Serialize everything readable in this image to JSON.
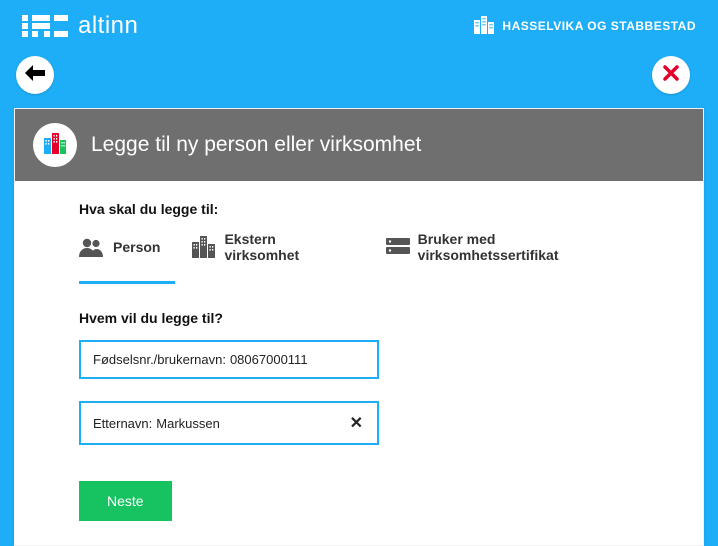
{
  "brand": {
    "name": "altinn"
  },
  "org": {
    "name": "HASSELVIKA OG STABBESTAD"
  },
  "panel": {
    "title": "Legge til ny person eller virksomhet",
    "what_label": "Hva skal du legge til:",
    "tabs": {
      "person": "Person",
      "ekstern": "Ekstern virksomhet",
      "bruker": "Bruker med virksomhetssertifikat"
    },
    "who_label": "Hvem vil du legge til?",
    "field1": {
      "label": "Fødselsnr./brukernavn:",
      "value": "08067000111"
    },
    "field2": {
      "label": "Etternavn:",
      "value": "Markussen"
    },
    "next_button": "Neste"
  }
}
